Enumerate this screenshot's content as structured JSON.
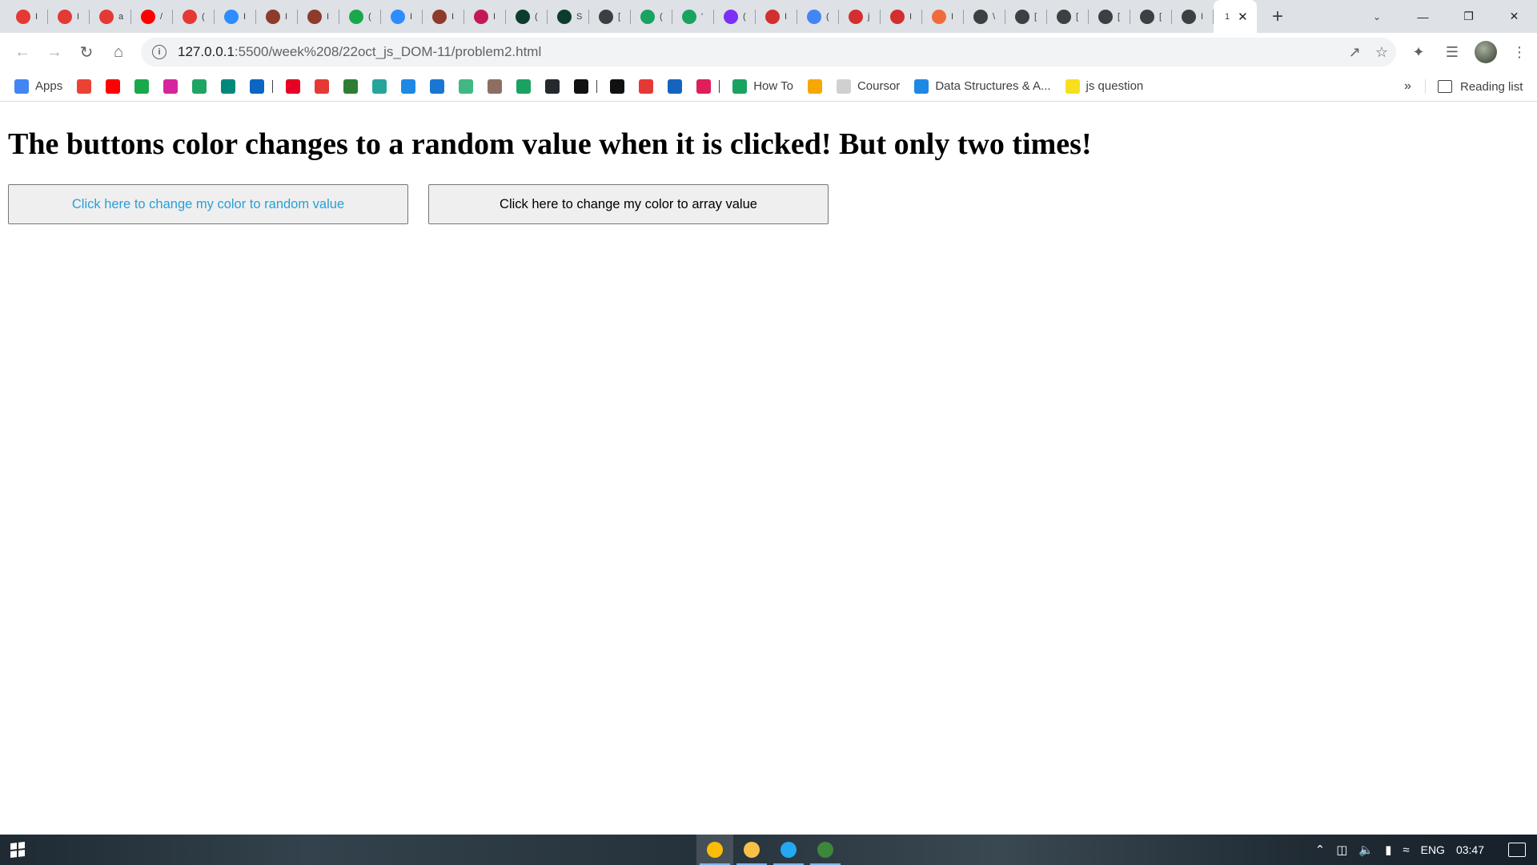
{
  "browser": {
    "tabs": [
      {
        "icon": "gear-red-icon",
        "color": "#e53935",
        "label": "I"
      },
      {
        "icon": "gear-red-icon",
        "color": "#e53935",
        "label": "I"
      },
      {
        "icon": "gear-red-icon",
        "color": "#e53935",
        "label": "a"
      },
      {
        "icon": "youtube-icon",
        "color": "#ff0000",
        "label": "/"
      },
      {
        "icon": "gear-red-icon",
        "color": "#e53935",
        "label": "("
      },
      {
        "icon": "zoom-icon",
        "color": "#2d8cff",
        "label": "I"
      },
      {
        "icon": "rocket-icon",
        "color": "#8d3b2b",
        "label": "I"
      },
      {
        "icon": "rocket-icon",
        "color": "#8d3b2b",
        "label": "I"
      },
      {
        "icon": "ten-icon",
        "color": "#19a94b",
        "label": "("
      },
      {
        "icon": "zoom-icon",
        "color": "#2d8cff",
        "label": "I"
      },
      {
        "icon": "rocket-icon",
        "color": "#8d3b2b",
        "label": "I"
      },
      {
        "icon": "m-icon",
        "color": "#c2185b",
        "label": "I"
      },
      {
        "icon": "leaf-icon",
        "color": "#0b3d2c",
        "label": "("
      },
      {
        "icon": "leaf-icon",
        "color": "#0b3d2c",
        "label": "S"
      },
      {
        "icon": "globe-icon",
        "color": "#3c4043",
        "label": "["
      },
      {
        "icon": "w-icon",
        "color": "#1aa260",
        "label": "("
      },
      {
        "icon": "w-icon",
        "color": "#1aa260",
        "label": "'"
      },
      {
        "icon": "check-icon",
        "color": "#7b2ff7",
        "label": "("
      },
      {
        "icon": "bracket-icon",
        "color": "#d32f2f",
        "label": "I"
      },
      {
        "icon": "doc-icon",
        "color": "#4285f4",
        "label": "("
      },
      {
        "icon": "bracket-icon",
        "color": "#d32f2f",
        "label": "j"
      },
      {
        "icon": "bracket-icon",
        "color": "#d32f2f",
        "label": "I"
      },
      {
        "icon": "clock-icon",
        "color": "#f06b3a",
        "label": "I"
      },
      {
        "icon": "globe-icon",
        "color": "#3c4043",
        "label": "\\"
      },
      {
        "icon": "globe-icon",
        "color": "#3c4043",
        "label": "["
      },
      {
        "icon": "globe-icon",
        "color": "#3c4043",
        "label": "["
      },
      {
        "icon": "globe-icon",
        "color": "#3c4043",
        "label": "["
      },
      {
        "icon": "globe-icon",
        "color": "#3c4043",
        "label": "["
      },
      {
        "icon": "globe-icon",
        "color": "#3c4043",
        "label": "I"
      }
    ],
    "active_tab": {
      "label": "1",
      "close": "✕"
    },
    "new_tab": "+",
    "url_host": "127.0.0.1",
    "url_rest": ":5500/week%208/22oct_js_DOM-11/problem2.html",
    "bookmarks": [
      {
        "icon": "apps-grid-icon",
        "color": "#4285f4",
        "label": "Apps"
      },
      {
        "icon": "gmail-icon",
        "color": "#ea4335",
        "label": ""
      },
      {
        "icon": "youtube-icon",
        "color": "#ff0000",
        "label": ""
      },
      {
        "icon": "ten-icon",
        "color": "#19a94b",
        "label": ""
      },
      {
        "icon": "instagram-icon",
        "color": "#d6249f",
        "label": ""
      },
      {
        "icon": "drive-icon",
        "color": "#1fa463",
        "label": ""
      },
      {
        "icon": "meet-icon",
        "color": "#00897b",
        "label": ""
      },
      {
        "icon": "linkedin-icon",
        "color": "#0a66c2",
        "label": ""
      },
      {
        "icon": "pinterest-icon",
        "color": "#e60023",
        "label": ""
      },
      {
        "icon": "record-icon",
        "color": "#e53935",
        "label": ""
      },
      {
        "icon": "px-icon",
        "color": "#2e7d32",
        "label": ""
      },
      {
        "icon": "p-icon",
        "color": "#26a69a",
        "label": ""
      },
      {
        "icon": "bot-icon",
        "color": "#1e88e5",
        "label": ""
      },
      {
        "icon": "flag-icon",
        "color": "#1976d2",
        "label": ""
      },
      {
        "icon": "vue-icon",
        "color": "#41b883",
        "label": ""
      },
      {
        "icon": "ppa-icon",
        "color": "#8d6e63",
        "label": ""
      },
      {
        "icon": "w-icon",
        "color": "#1aa260",
        "label": ""
      },
      {
        "icon": "github-icon",
        "color": "#24292e",
        "label": ""
      },
      {
        "icon": "codepen-icon",
        "color": "#111111",
        "label": ""
      },
      {
        "icon": "target-icon",
        "color": "#111111",
        "label": ""
      },
      {
        "icon": "gear-red-icon",
        "color": "#e53935",
        "label": ""
      },
      {
        "icon": "mail-icon",
        "color": "#1565c0",
        "label": ""
      },
      {
        "icon": "slack-icon",
        "color": "#e01e5a",
        "label": ""
      },
      {
        "icon": "w-icon",
        "color": "#1aa260",
        "label": "How To"
      },
      {
        "icon": "h-icon",
        "color": "#f6a800",
        "label": ""
      },
      {
        "icon": "c-icon",
        "color": "#d0d0d0",
        "label": "Coursor"
      },
      {
        "icon": "u-icon",
        "color": "#1e88e5",
        "label": "Data Structures & A..."
      },
      {
        "icon": "js-icon",
        "color": "#f7df1e",
        "label": "js question"
      }
    ],
    "bookmarks_more": "»",
    "reading_list": "Reading list"
  },
  "page": {
    "heading": "The buttons color changes to a random value when it is clicked! But only two times!",
    "button_random": {
      "label": "Click here to change my color to random value",
      "text_color": "#2a9fd6"
    },
    "button_array": {
      "label": "Click here to change my color to array value",
      "text_color": "#000000"
    }
  },
  "taskbar": {
    "apps": [
      {
        "icon": "chrome-icon",
        "color": "#fbbc05",
        "active": true
      },
      {
        "icon": "file-explorer-icon",
        "color": "#f8c146",
        "active": false
      },
      {
        "icon": "vscode-icon",
        "color": "#23a9f2",
        "active": false
      },
      {
        "icon": "node-icon",
        "color": "#3c873a",
        "active": false
      }
    ],
    "language": "ENG",
    "time": "03:47"
  }
}
